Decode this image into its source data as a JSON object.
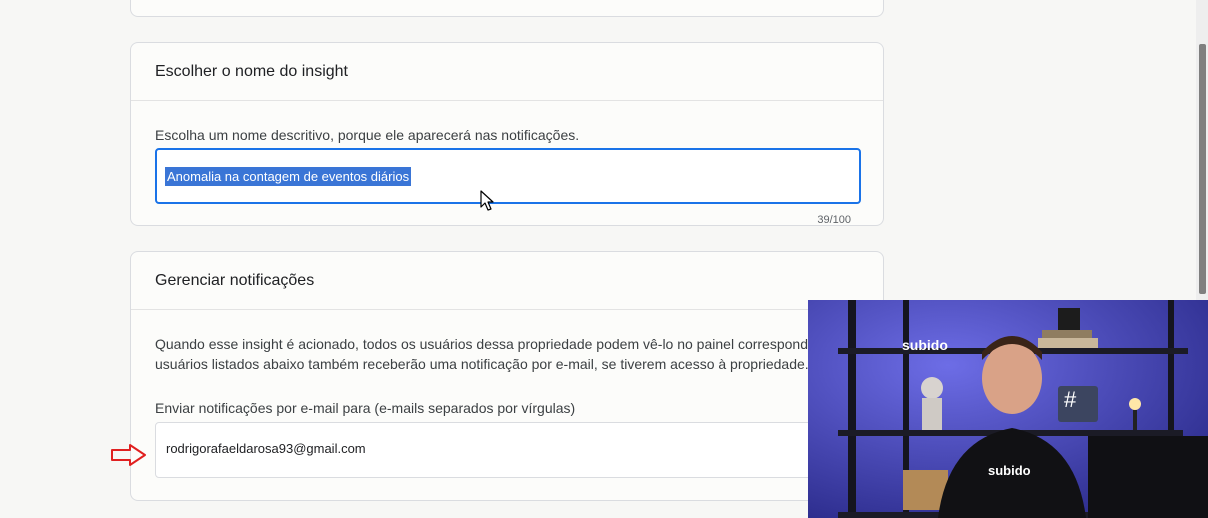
{
  "insight_card": {
    "title": "Escolher o nome do insight",
    "description": "Escolha um nome descritivo, porque ele aparecerá nas notificações.",
    "name_value": "Anomalia na contagem de eventos diários",
    "counter": "39/100"
  },
  "notification_card": {
    "title": "Gerenciar notificações",
    "description_line1": "Quando esse insight é acionado, todos os usuários dessa propriedade podem vê-lo no painel correspondente.",
    "description_line2": "usuários listados abaixo também receberão uma notificação por e-mail, se tiverem acesso à propriedade.",
    "email_label": "Enviar notificações por e-mail para (e-mails separados por vírgulas)",
    "email_value": "rodrigorafaeldarosa93@gmail.com"
  },
  "webcam": {
    "sign_text": "subido",
    "shirt_text": "subido",
    "hash_icon": "#"
  },
  "colors": {
    "accent": "#1a73e8",
    "selection": "#3a75d6",
    "arrow": "#e02020",
    "webcam_bg": "#3b3ab0"
  },
  "icons": [
    "mouse-cursor-icon",
    "red-arrow-icon",
    "hashtag-icon"
  ]
}
